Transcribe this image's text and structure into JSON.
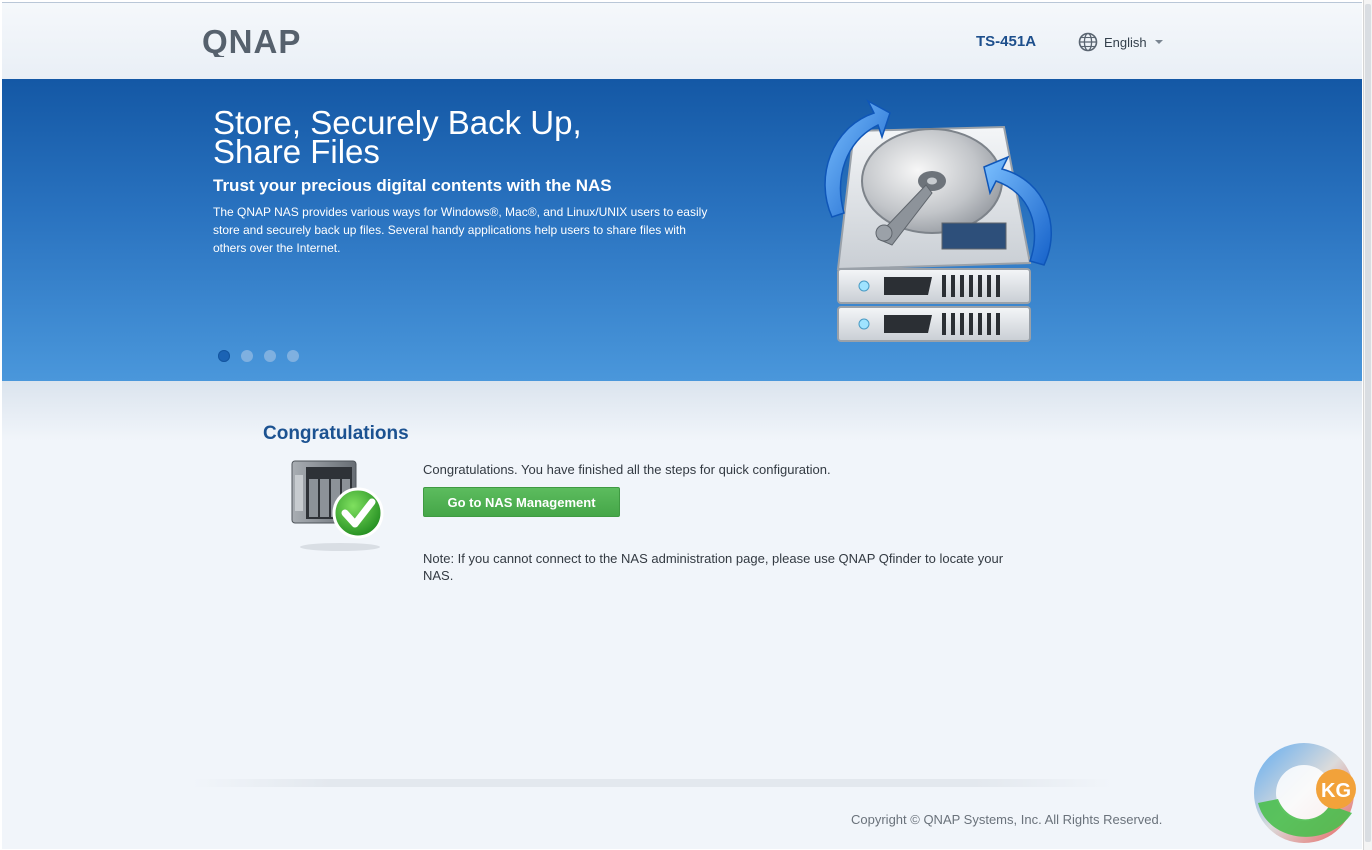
{
  "header": {
    "logo_text": "QNAP",
    "model": "TS-451A",
    "language": "English"
  },
  "banner": {
    "title_line1": "Store, Securely Back Up,",
    "title_line2": "Share Files",
    "subtitle": "Trust your precious digital contents with the NAS",
    "description": "The QNAP NAS provides various ways for Windows®, Mac®, and Linux/UNIX users to easily store and securely back up files. Several handy applications help users to share files with others over the Internet.",
    "slides_total": 4,
    "slide_active": 1
  },
  "content": {
    "title": "Congratulations",
    "message": "Congratulations. You have finished all the steps for quick configuration.",
    "button_label": "Go to NAS Management",
    "note": "Note: If you cannot connect to the NAS administration page, please use QNAP Qfinder to locate your NAS."
  },
  "footer": {
    "copyright": "Copyright © QNAP Systems, Inc. All Rights Reserved."
  },
  "watermark": {
    "text": "KG"
  },
  "colors": {
    "banner_blue": "#2a73c0",
    "title_blue": "#1c5291",
    "button_green": "#4cae4f"
  }
}
